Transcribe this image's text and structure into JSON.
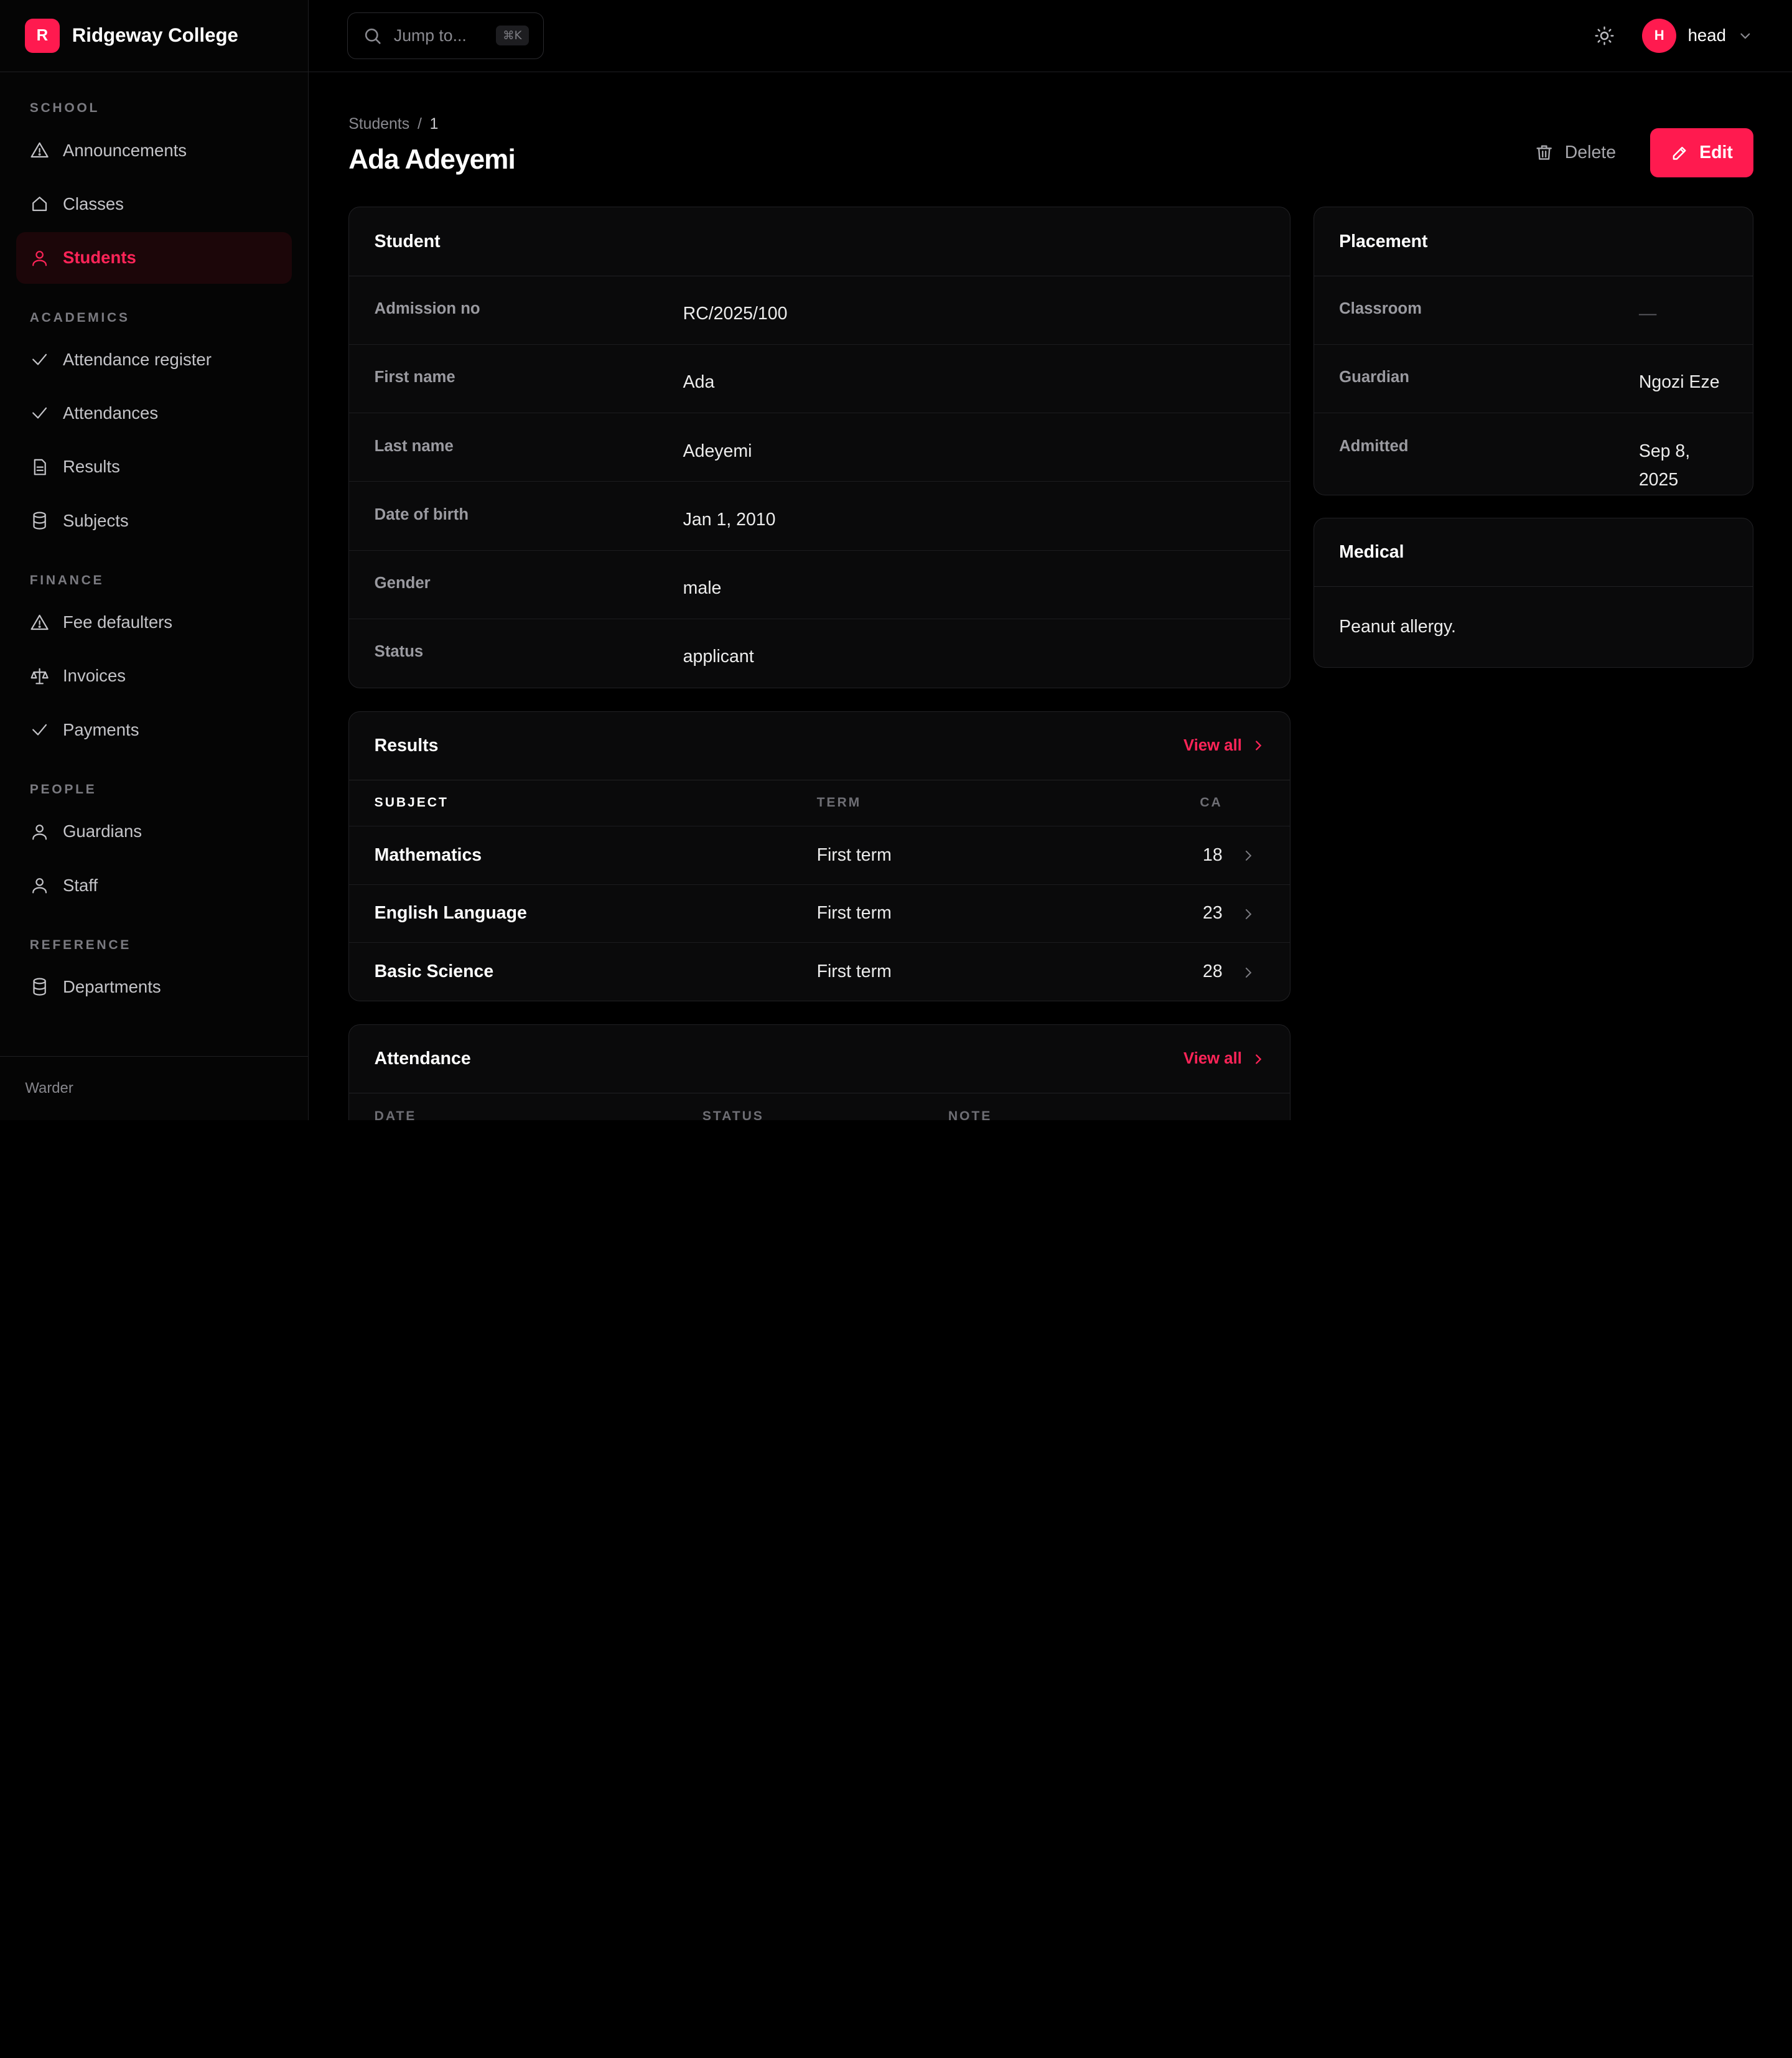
{
  "brand": {
    "logo_letter": "R",
    "name": "Ridgeway College",
    "accent": "#ff1a4f"
  },
  "sidebar": {
    "sections": [
      {
        "title": "SCHOOL",
        "items": [
          {
            "label": "Announcements",
            "icon": "warning-icon"
          },
          {
            "label": "Classes",
            "icon": "home-icon"
          },
          {
            "label": "Students",
            "icon": "user-icon",
            "active": true
          }
        ]
      },
      {
        "title": "ACADEMICS",
        "items": [
          {
            "label": "Attendance register",
            "icon": "check-icon"
          },
          {
            "label": "Attendances",
            "icon": "check-icon"
          },
          {
            "label": "Results",
            "icon": "document-icon"
          },
          {
            "label": "Subjects",
            "icon": "database-icon"
          }
        ]
      },
      {
        "title": "FINANCE",
        "items": [
          {
            "label": "Fee defaulters",
            "icon": "warning-icon"
          },
          {
            "label": "Invoices",
            "icon": "scale-icon"
          },
          {
            "label": "Payments",
            "icon": "check-icon"
          }
        ]
      },
      {
        "title": "PEOPLE",
        "items": [
          {
            "label": "Guardians",
            "icon": "user-icon"
          },
          {
            "label": "Staff",
            "icon": "user-icon"
          }
        ]
      },
      {
        "title": "REFERENCE",
        "items": [
          {
            "label": "Departments",
            "icon": "database-icon"
          }
        ]
      }
    ],
    "footer": "Warder"
  },
  "topbar": {
    "search_placeholder": "Jump to...",
    "search_shortcut": "⌘K",
    "user": {
      "initial": "H",
      "name": "head"
    }
  },
  "page": {
    "breadcrumb": {
      "parent": "Students",
      "separator": "/",
      "current": "1"
    },
    "title": "Ada Adeyemi",
    "delete_label": "Delete",
    "edit_label": "Edit"
  },
  "student_card": {
    "title": "Student",
    "fields": [
      {
        "label": "Admission no",
        "value": "RC/2025/100"
      },
      {
        "label": "First name",
        "value": "Ada"
      },
      {
        "label": "Last name",
        "value": "Adeyemi"
      },
      {
        "label": "Date of birth",
        "value": "Jan 1, 2010"
      },
      {
        "label": "Gender",
        "value": "male"
      },
      {
        "label": "Status",
        "value": "applicant"
      }
    ]
  },
  "placement_card": {
    "title": "Placement",
    "fields": [
      {
        "label": "Classroom",
        "value": "—"
      },
      {
        "label": "Guardian",
        "value": "Ngozi Eze"
      },
      {
        "label": "Admitted",
        "value": "Sep 8, 2025"
      }
    ]
  },
  "medical_card": {
    "title": "Medical",
    "body": "Peanut allergy."
  },
  "results_card": {
    "title": "Results",
    "view_all": "View all",
    "columns": [
      "SUBJECT",
      "TERM",
      "CA"
    ],
    "rows": [
      {
        "subject": "Mathematics",
        "term": "First term",
        "ca": "18"
      },
      {
        "subject": "English Language",
        "term": "First term",
        "ca": "23"
      },
      {
        "subject": "Basic Science",
        "term": "First term",
        "ca": "28"
      }
    ]
  },
  "attendance_card": {
    "title": "Attendance",
    "view_all": "View all",
    "columns": [
      "DATE",
      "STATUS",
      "NOTE"
    ]
  }
}
